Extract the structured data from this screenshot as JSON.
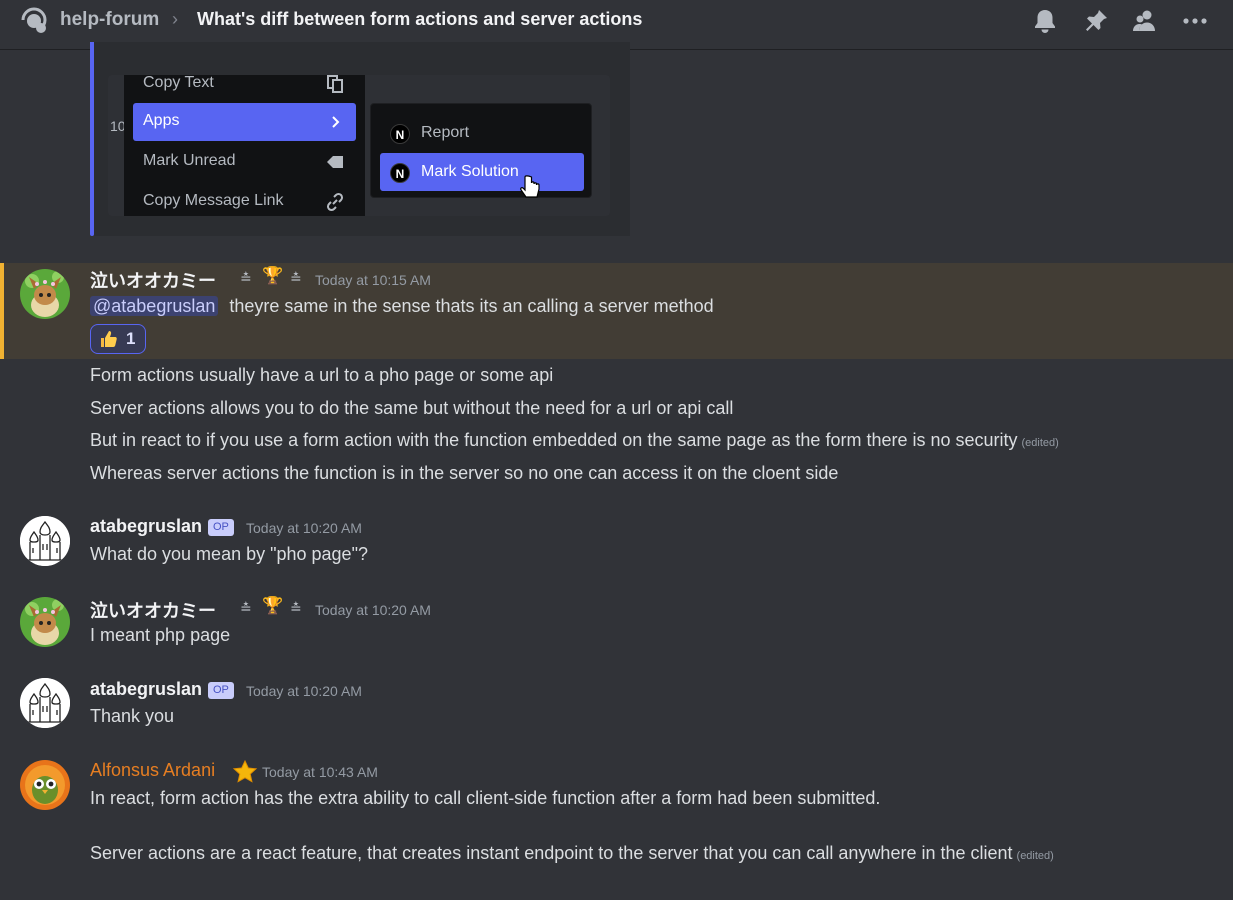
{
  "header": {
    "channel": "help-forum",
    "separator": "›",
    "thread_title": "What's diff between form actions and server actions"
  },
  "embed": {
    "menu": {
      "items": [
        {
          "label": "Copy Text",
          "icon": "copy-icon"
        },
        {
          "label": "Apps",
          "icon": "chevron-right-icon"
        },
        {
          "label": "Mark Unread",
          "icon": "mark-unread-icon"
        },
        {
          "label": "Copy Message Link",
          "icon": "link-icon"
        }
      ],
      "submenu": [
        {
          "label": "Report",
          "icon": "nextjs-icon"
        },
        {
          "label": "Mark Solution",
          "icon": "nextjs-icon"
        }
      ],
      "fragment": "10"
    }
  },
  "messages": [
    {
      "author": "泣いオオカミー",
      "timestamp": "Today at 10:15 AM",
      "mention": "@atabegruslan",
      "text": "theyre same in the sense thats its an calling a server method",
      "reaction": {
        "emoji": "thumbs-up-icon",
        "count": "1"
      }
    },
    {
      "continuations": [
        "Form actions usually have a url to a pho page or some api",
        "Server actions allows you to do the same but without the need for a url or api call",
        "But in react to if you use a form action with the function embedded on the same page as the form there is no security",
        "Whereas server actions the function is in the server so no one can access it on the cloent side"
      ],
      "edited": "(edited)"
    },
    {
      "author": "atabegruslan",
      "badge": "OP",
      "timestamp": "Today at 10:20 AM",
      "text": "What do you mean by \"pho page\"?"
    },
    {
      "author": "泣いオオカミー",
      "timestamp": "Today at 10:20 AM",
      "text": "I meant php page"
    },
    {
      "author": "atabegruslan",
      "badge": "OP",
      "timestamp": "Today at 10:20 AM",
      "text": "Thank you"
    },
    {
      "author": "Alfonsus Ardani",
      "timestamp": "Today at 10:43 AM",
      "text": "In react, form action has the extra ability to call client-side function after a form had been submitted.",
      "text2": "Server actions are a react feature, that creates instant endpoint to the server that you can call anywhere in the client",
      "edited": "(edited)"
    }
  ],
  "colors": {
    "background": "#313338",
    "accent": "#5865f2",
    "highlight": "#423d35",
    "highlight_border": "#f0b232",
    "alfonsus_name": "#e67e22"
  }
}
